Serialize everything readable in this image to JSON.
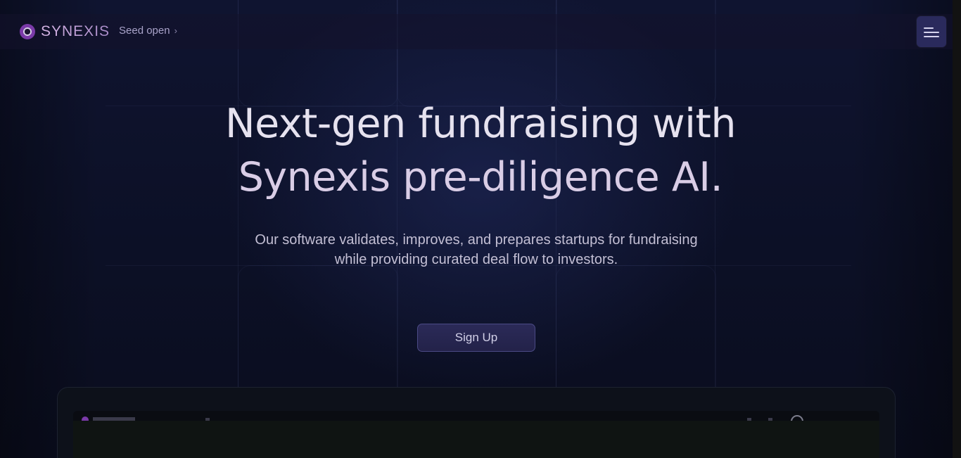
{
  "nav": {
    "brand": "SYNEXIS",
    "seed_label": "Seed open",
    "seed_chevron": "›",
    "menu_icon": "hamburger-menu-icon"
  },
  "hero": {
    "title_line1": "Next-gen fundraising with",
    "title_line2": "Synexis pre-diligence AI.",
    "subtitle_line1": "Our software validates, improves, and prepares startups for fundraising",
    "subtitle_line2": "while providing curated deal flow to investors.",
    "cta_label": "Sign Up"
  },
  "colors": {
    "background": "#0b0e1d",
    "accent_purple": "#7a3aa8",
    "button_bg": "#2a2a5c",
    "text_primary": "#e6e2ef"
  }
}
